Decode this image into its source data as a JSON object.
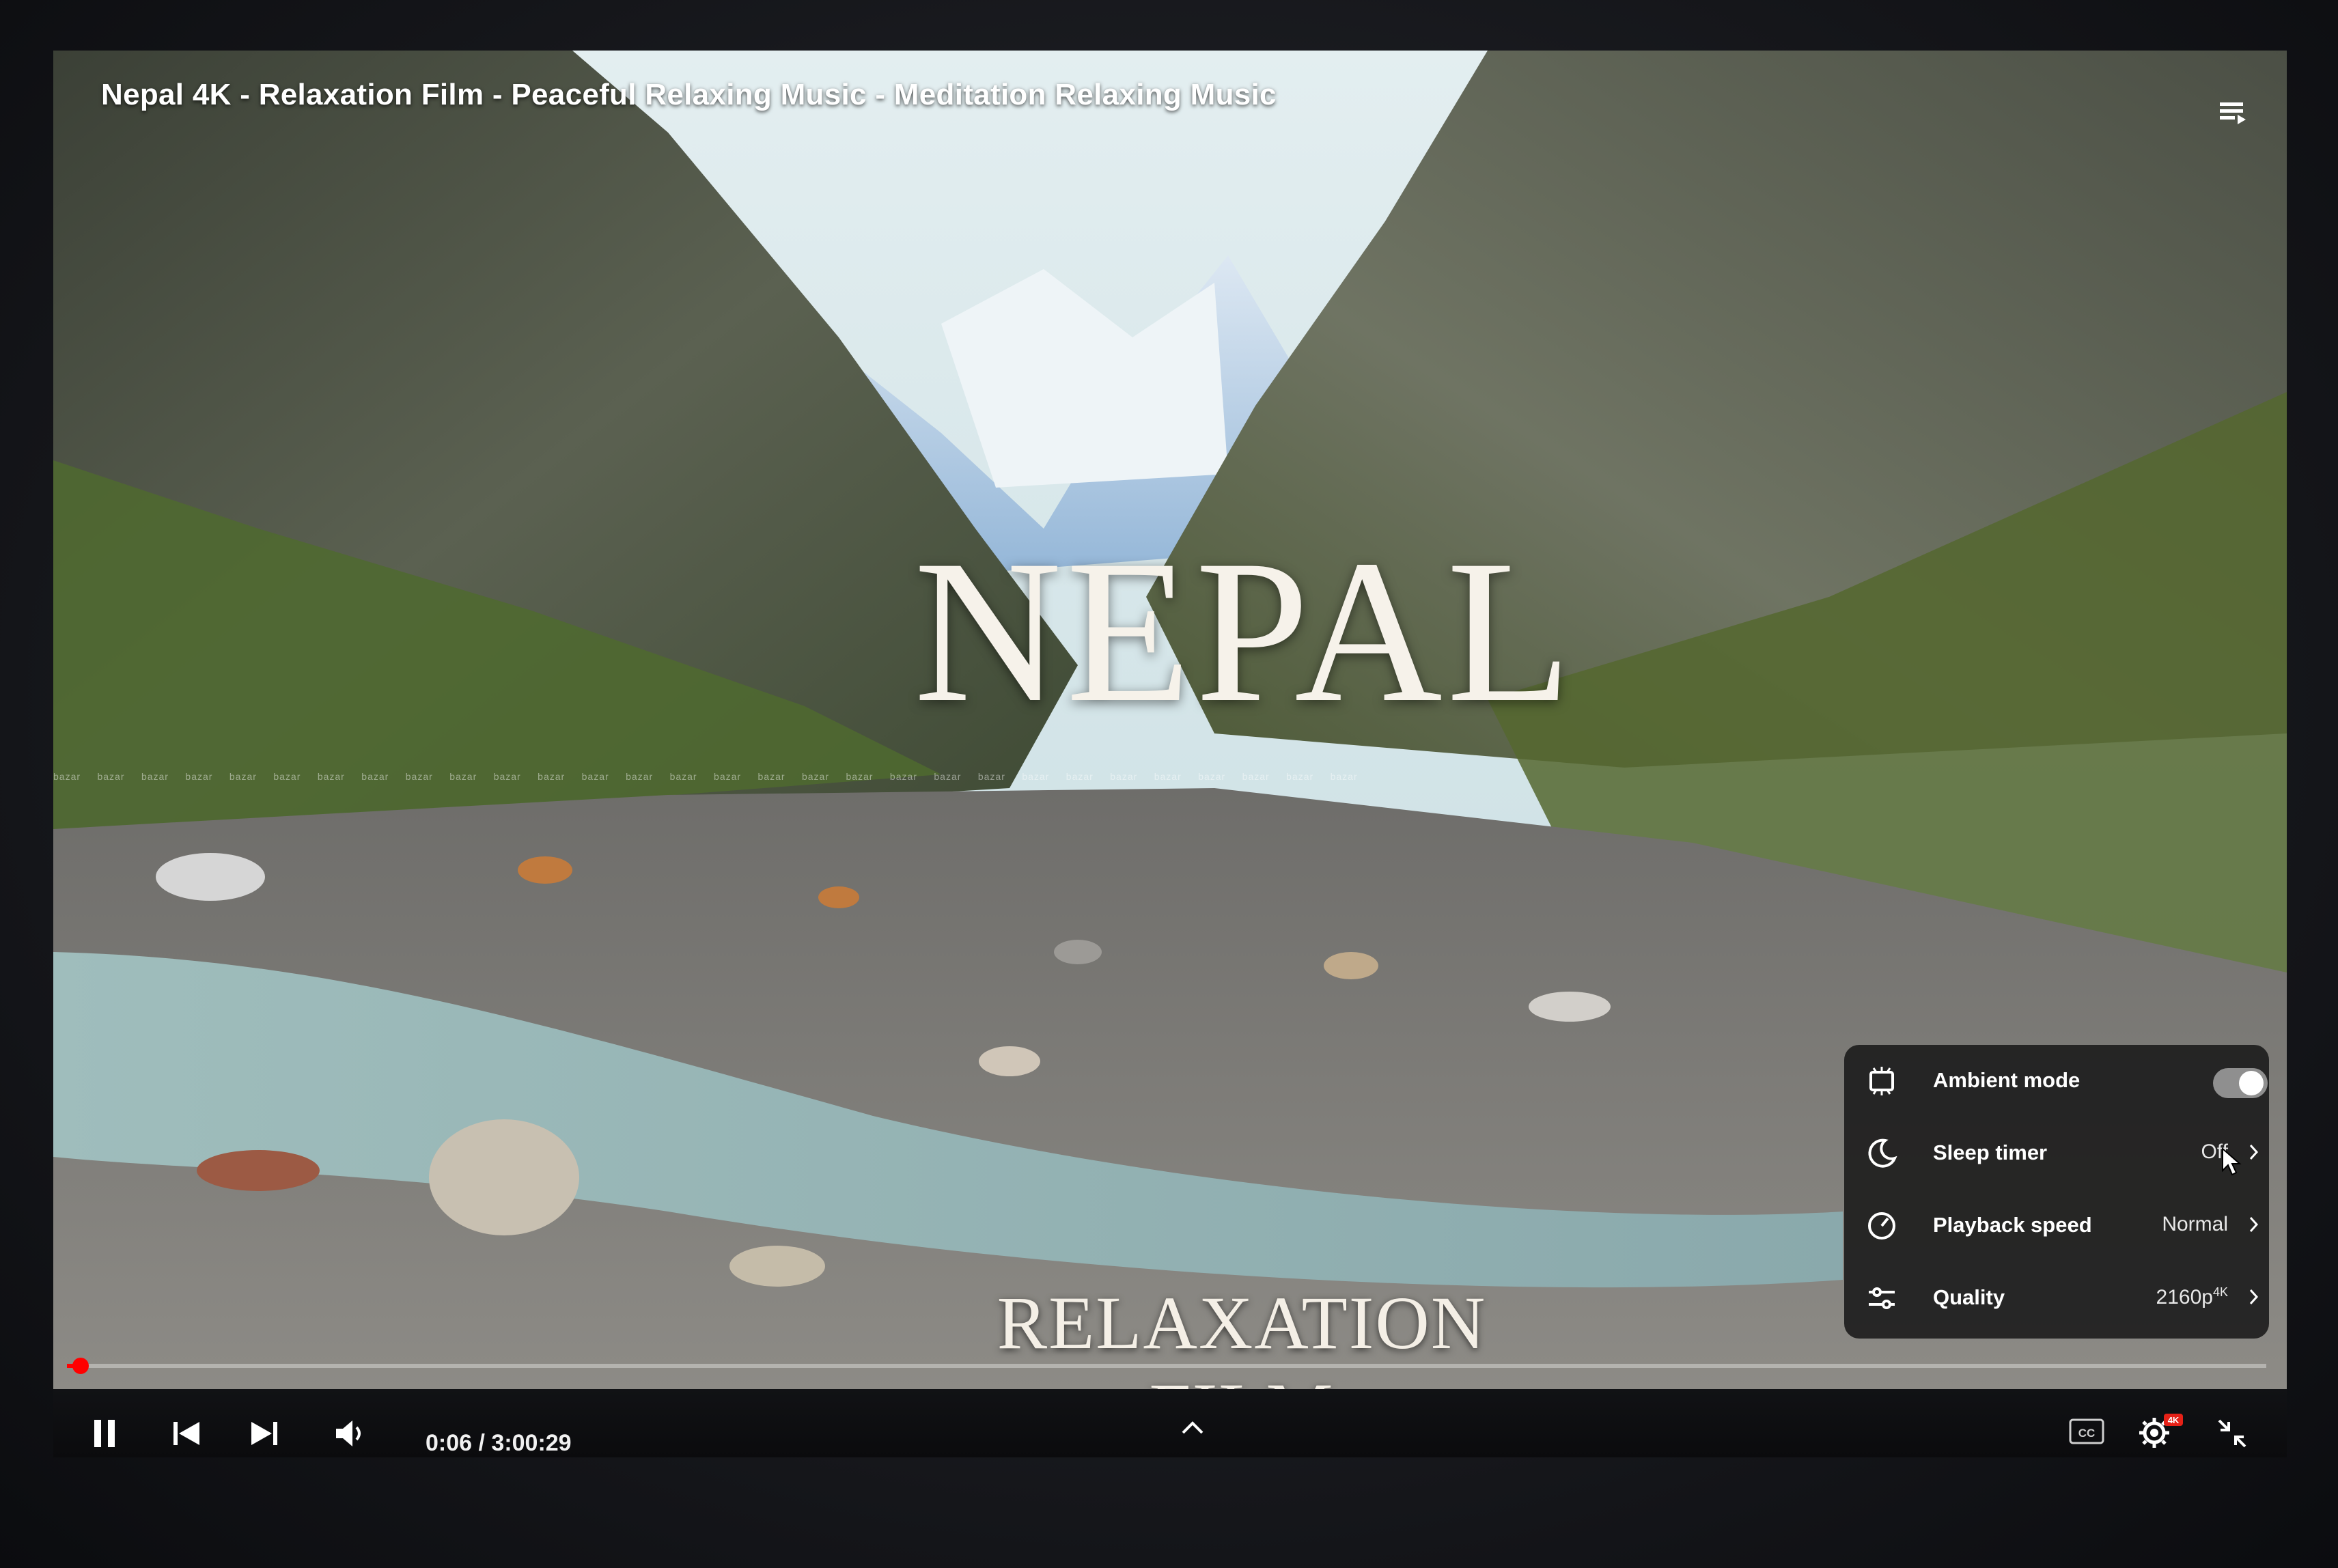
{
  "video": {
    "title": "Nepal 4K - Relaxation Film - Peaceful Relaxing Music - Meditation Relaxing Music",
    "overlay_title": "NEPAL",
    "overlay_subtitle": "RELAXATION FILM",
    "watermark": "bazar     bazar     bazar     bazar     bazar     bazar     bazar     bazar     bazar     bazar     bazar     bazar     bazar     bazar     bazar     bazar     bazar     bazar     bazar     bazar     bazar     bazar     bazar     bazar     bazar     bazar     bazar     bazar     bazar     bazar"
  },
  "player": {
    "time_display": "0:06 / 3:00:29",
    "progress_fraction": 0.00055,
    "progress_color": "#ff0000",
    "icons": {
      "play_pause": "pause-icon",
      "previous": "previous-icon",
      "next": "next-icon",
      "volume": "volume-icon",
      "expand": "chevron-up-icon",
      "captions": "captions-icon",
      "settings": "settings-gear-icon",
      "settings_badge": "4K",
      "fullscreen": "exit-fullscreen-icon",
      "playlist": "playlist-icon"
    }
  },
  "settings_menu": {
    "items": [
      {
        "icon": "ambient-mode-icon",
        "label": "Ambient mode",
        "value": "",
        "toggle_on": true
      },
      {
        "icon": "sleep-timer-icon",
        "label": "Sleep timer",
        "value": "Off"
      },
      {
        "icon": "playback-speed-icon",
        "label": "Playback speed",
        "value": "Normal"
      },
      {
        "icon": "quality-icon",
        "label": "Quality",
        "value": "2160p",
        "value_badge": "4K"
      }
    ]
  }
}
